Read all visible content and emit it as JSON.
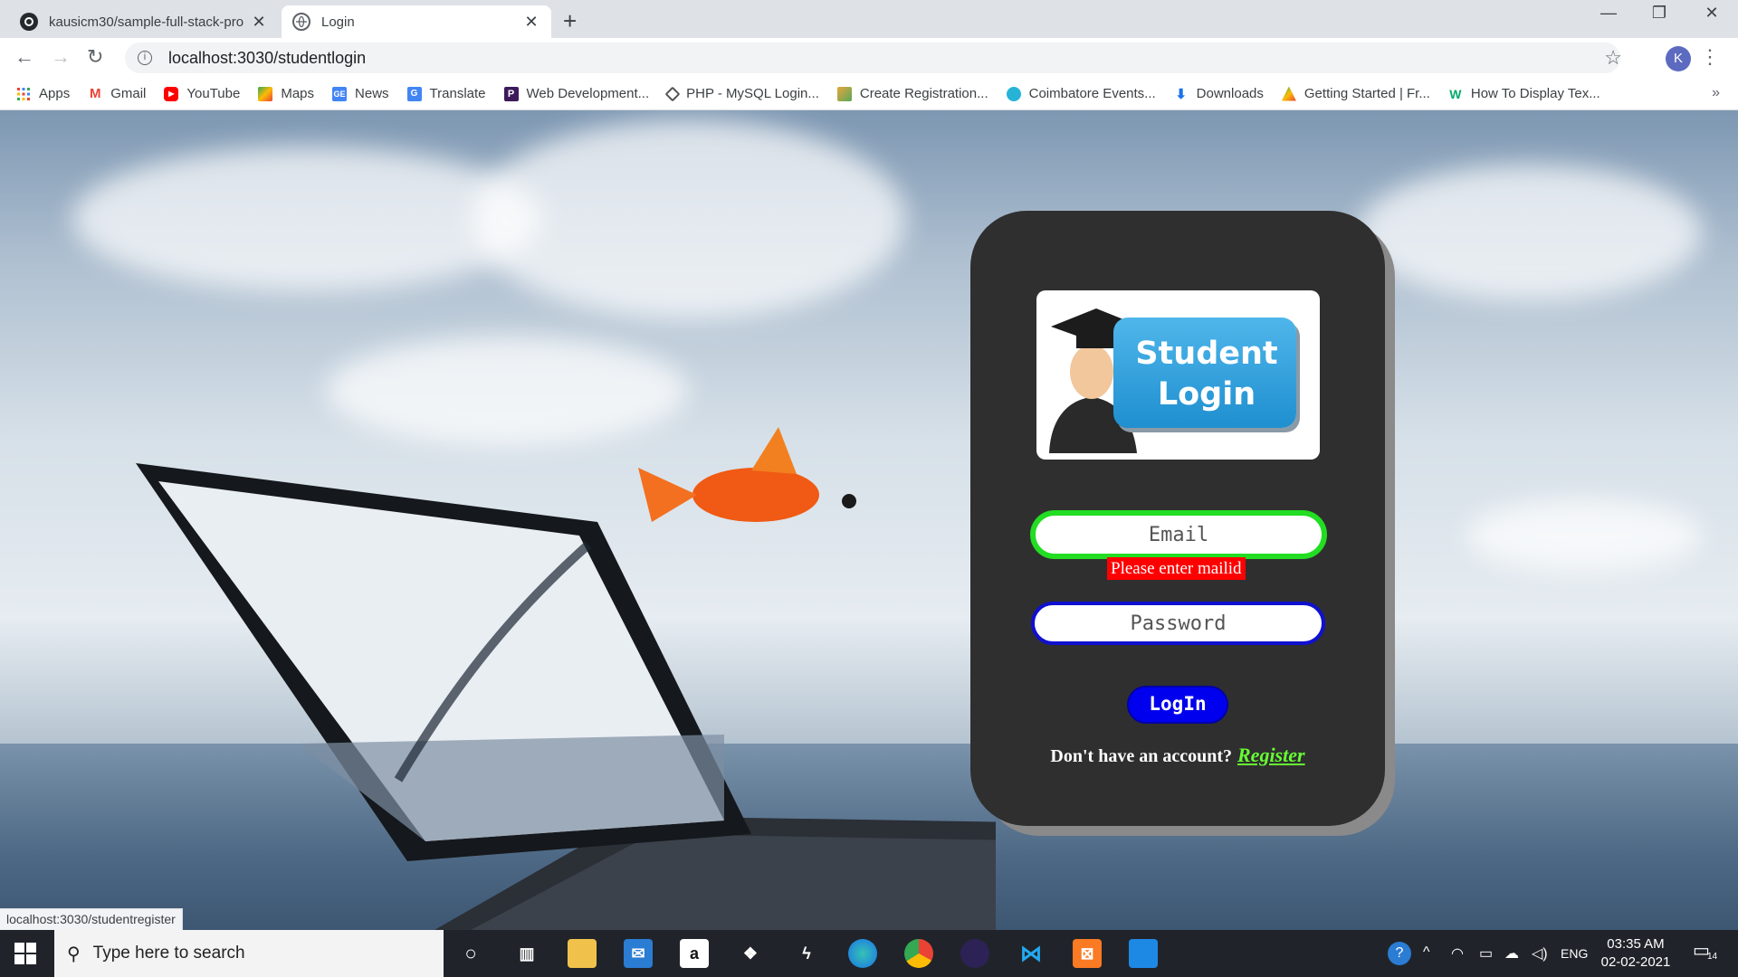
{
  "tabs": [
    {
      "title": "kausicm30/sample-full-stack-pro",
      "favicon": "github-icon"
    },
    {
      "title": "Login",
      "favicon": "globe-icon"
    }
  ],
  "window_controls": {
    "minimize": "—",
    "restore": "❐",
    "close": "✕"
  },
  "address_bar": {
    "url": "localhost:3030/studentlogin"
  },
  "profile_initial": "K",
  "bookmarks": [
    {
      "label": "Apps",
      "icon": "apps-grid-icon"
    },
    {
      "label": "Gmail",
      "icon": "gmail-icon"
    },
    {
      "label": "YouTube",
      "icon": "youtube-icon"
    },
    {
      "label": "Maps",
      "icon": "maps-icon"
    },
    {
      "label": "News",
      "icon": "news-icon"
    },
    {
      "label": "Translate",
      "icon": "translate-icon"
    },
    {
      "label": "Web Development...",
      "icon": "bookmark-icon"
    },
    {
      "label": "PHP - MySQL Login...",
      "icon": "bookmark-icon"
    },
    {
      "label": "Create Registration...",
      "icon": "bookmark-icon"
    },
    {
      "label": "Coimbatore Events...",
      "icon": "bookmark-icon"
    },
    {
      "label": "Downloads",
      "icon": "download-icon"
    },
    {
      "label": "Getting Started | Fr...",
      "icon": "bookmark-icon"
    },
    {
      "label": "How To Display Tex...",
      "icon": "w3schools-icon"
    }
  ],
  "login": {
    "logo_line1": "Student",
    "logo_line2": "Login",
    "email_placeholder": "Email",
    "email_error": "Please enter mailid",
    "password_placeholder": "Password",
    "login_button": "LogIn",
    "register_prompt": "Don't have an account?",
    "register_link": "Register"
  },
  "status_bar": "localhost:3030/studentregister",
  "taskbar": {
    "search_placeholder": "Type here to search",
    "language": "ENG",
    "time": "03:35 AM",
    "date": "02-02-2021",
    "notification_count": "14"
  },
  "colors": {
    "card": "#2f2f2f",
    "email_border": "#22dd22",
    "password_border": "#1010d0",
    "button": "#0000ee",
    "error": "#ff0000",
    "register_link": "#66ff33"
  }
}
